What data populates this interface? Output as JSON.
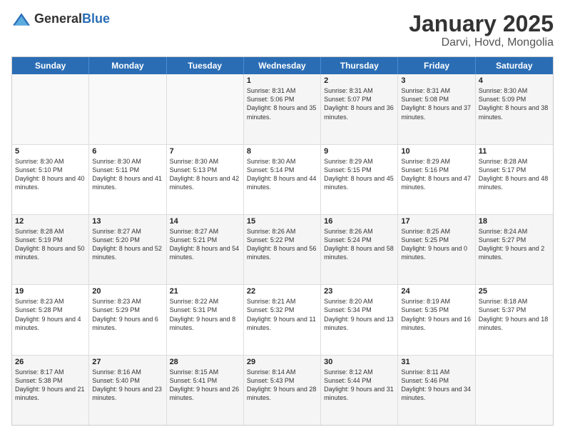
{
  "logo": {
    "general": "General",
    "blue": "Blue"
  },
  "title": "January 2025",
  "subtitle": "Darvi, Hovd, Mongolia",
  "weekdays": [
    "Sunday",
    "Monday",
    "Tuesday",
    "Wednesday",
    "Thursday",
    "Friday",
    "Saturday"
  ],
  "weeks": [
    [
      {
        "day": "",
        "empty": true
      },
      {
        "day": "",
        "empty": true
      },
      {
        "day": "",
        "empty": true
      },
      {
        "day": "1",
        "sunrise": "8:31 AM",
        "sunset": "5:06 PM",
        "daylight": "8 hours and 35 minutes."
      },
      {
        "day": "2",
        "sunrise": "8:31 AM",
        "sunset": "5:07 PM",
        "daylight": "8 hours and 36 minutes."
      },
      {
        "day": "3",
        "sunrise": "8:31 AM",
        "sunset": "5:08 PM",
        "daylight": "8 hours and 37 minutes."
      },
      {
        "day": "4",
        "sunrise": "8:30 AM",
        "sunset": "5:09 PM",
        "daylight": "8 hours and 38 minutes."
      }
    ],
    [
      {
        "day": "5",
        "sunrise": "8:30 AM",
        "sunset": "5:10 PM",
        "daylight": "8 hours and 40 minutes."
      },
      {
        "day": "6",
        "sunrise": "8:30 AM",
        "sunset": "5:11 PM",
        "daylight": "8 hours and 41 minutes."
      },
      {
        "day": "7",
        "sunrise": "8:30 AM",
        "sunset": "5:13 PM",
        "daylight": "8 hours and 42 minutes."
      },
      {
        "day": "8",
        "sunrise": "8:30 AM",
        "sunset": "5:14 PM",
        "daylight": "8 hours and 44 minutes."
      },
      {
        "day": "9",
        "sunrise": "8:29 AM",
        "sunset": "5:15 PM",
        "daylight": "8 hours and 45 minutes."
      },
      {
        "day": "10",
        "sunrise": "8:29 AM",
        "sunset": "5:16 PM",
        "daylight": "8 hours and 47 minutes."
      },
      {
        "day": "11",
        "sunrise": "8:28 AM",
        "sunset": "5:17 PM",
        "daylight": "8 hours and 48 minutes."
      }
    ],
    [
      {
        "day": "12",
        "sunrise": "8:28 AM",
        "sunset": "5:19 PM",
        "daylight": "8 hours and 50 minutes."
      },
      {
        "day": "13",
        "sunrise": "8:27 AM",
        "sunset": "5:20 PM",
        "daylight": "8 hours and 52 minutes."
      },
      {
        "day": "14",
        "sunrise": "8:27 AM",
        "sunset": "5:21 PM",
        "daylight": "8 hours and 54 minutes."
      },
      {
        "day": "15",
        "sunrise": "8:26 AM",
        "sunset": "5:22 PM",
        "daylight": "8 hours and 56 minutes."
      },
      {
        "day": "16",
        "sunrise": "8:26 AM",
        "sunset": "5:24 PM",
        "daylight": "8 hours and 58 minutes."
      },
      {
        "day": "17",
        "sunrise": "8:25 AM",
        "sunset": "5:25 PM",
        "daylight": "9 hours and 0 minutes."
      },
      {
        "day": "18",
        "sunrise": "8:24 AM",
        "sunset": "5:27 PM",
        "daylight": "9 hours and 2 minutes."
      }
    ],
    [
      {
        "day": "19",
        "sunrise": "8:23 AM",
        "sunset": "5:28 PM",
        "daylight": "9 hours and 4 minutes."
      },
      {
        "day": "20",
        "sunrise": "8:23 AM",
        "sunset": "5:29 PM",
        "daylight": "9 hours and 6 minutes."
      },
      {
        "day": "21",
        "sunrise": "8:22 AM",
        "sunset": "5:31 PM",
        "daylight": "9 hours and 8 minutes."
      },
      {
        "day": "22",
        "sunrise": "8:21 AM",
        "sunset": "5:32 PM",
        "daylight": "9 hours and 11 minutes."
      },
      {
        "day": "23",
        "sunrise": "8:20 AM",
        "sunset": "5:34 PM",
        "daylight": "9 hours and 13 minutes."
      },
      {
        "day": "24",
        "sunrise": "8:19 AM",
        "sunset": "5:35 PM",
        "daylight": "9 hours and 16 minutes."
      },
      {
        "day": "25",
        "sunrise": "8:18 AM",
        "sunset": "5:37 PM",
        "daylight": "9 hours and 18 minutes."
      }
    ],
    [
      {
        "day": "26",
        "sunrise": "8:17 AM",
        "sunset": "5:38 PM",
        "daylight": "9 hours and 21 minutes."
      },
      {
        "day": "27",
        "sunrise": "8:16 AM",
        "sunset": "5:40 PM",
        "daylight": "9 hours and 23 minutes."
      },
      {
        "day": "28",
        "sunrise": "8:15 AM",
        "sunset": "5:41 PM",
        "daylight": "9 hours and 26 minutes."
      },
      {
        "day": "29",
        "sunrise": "8:14 AM",
        "sunset": "5:43 PM",
        "daylight": "9 hours and 28 minutes."
      },
      {
        "day": "30",
        "sunrise": "8:12 AM",
        "sunset": "5:44 PM",
        "daylight": "9 hours and 31 minutes."
      },
      {
        "day": "31",
        "sunrise": "8:11 AM",
        "sunset": "5:46 PM",
        "daylight": "9 hours and 34 minutes."
      },
      {
        "day": "",
        "empty": true
      }
    ]
  ]
}
